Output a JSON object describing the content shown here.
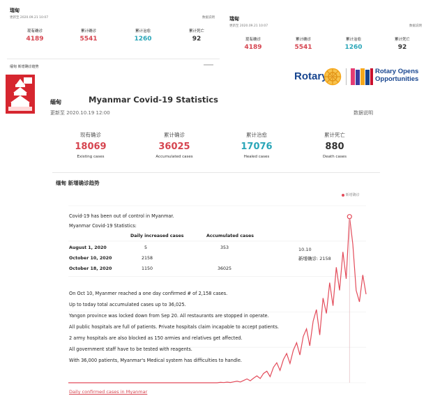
{
  "top_left": {
    "title": "瑞甸",
    "updated": "更新至 2020.09.21 10:07",
    "link": "数据说明",
    "stats": [
      {
        "label": "现有确诊",
        "value": "4189"
      },
      {
        "label": "累计确诊",
        "value": "5541"
      },
      {
        "label": "累计治愈",
        "value": "1260"
      },
      {
        "label": "累计死亡",
        "value": "92"
      }
    ],
    "trend": "缅甸 新增确诊趋势"
  },
  "top_right": {
    "title": "瑞甸",
    "updated": "更新至 2020.09.21 10:07",
    "link": "数据说明",
    "stats": [
      {
        "label": "现有确诊",
        "value": "4189"
      },
      {
        "label": "累计确诊",
        "value": "5541"
      },
      {
        "label": "累计治愈",
        "value": "1260"
      },
      {
        "label": "累计死亡",
        "value": "92"
      }
    ]
  },
  "rotary": {
    "wordmark": "Rotary",
    "slogan_line1": "Rotary Opens",
    "slogan_line2": "Opportunities"
  },
  "main": {
    "title": "Myanmar Covid-19 Statistics",
    "country": "缅甸",
    "updated": "更新至 2020.10.19 12:00",
    "link": "数据说明",
    "stats": [
      {
        "label": "现有确诊",
        "value": "18069",
        "en": "Existing cases"
      },
      {
        "label": "累计确诊",
        "value": "36025",
        "en": "Accumulated cases"
      },
      {
        "label": "累计治愈",
        "value": "17076",
        "en": "Healed cases"
      },
      {
        "label": "累计死亡",
        "value": "880",
        "en": "Death cases"
      }
    ],
    "trend_title": "缅甸 新增确诊趋势",
    "legend": "新增确诊"
  },
  "notes": {
    "line1": "Covid-19 has been out of control in Myanmar.",
    "line2": "Myanmar Covid-19 Statistics:",
    "table": {
      "headers": [
        "Daily increased cases",
        "Accumulated cases"
      ],
      "rows": [
        {
          "date": "August 1, 2020",
          "daily": "5",
          "acc": "353"
        },
        {
          "date": "October 10, 2020",
          "daily": "2158",
          "acc": ""
        },
        {
          "date": "October 18, 2020",
          "daily": "1150",
          "acc": "36025"
        }
      ]
    },
    "paras": [
      "On Oct 10, Myanmer reached a one day confirmed # of 2,158 cases.",
      "Up to today total accumulated cases up to 36,025.",
      "Yangon province was locked down from Sep 20. All restaurants are stopped in operate.",
      "All public hospitals are full of patients. Private hospitals claim incapable to accept patients.",
      "2 army hospitals are also blocked as 150 armies and relatives get affected.",
      "All government staff have to be tested with reagents.",
      "With 36,000 patients, Myanmar's Medical system has difficulties to handle."
    ]
  },
  "tooltip": {
    "date": "10.10",
    "label": "新增确诊",
    "value": "2158"
  },
  "caption": "Daily confirmed cases in Myanmar",
  "colors": {
    "red": "#d64550",
    "teal": "#2aa6b8",
    "line": "#e34b5a",
    "rotary_blue": "#17458f",
    "rotary_gold": "#f7a81b"
  },
  "chart_data": {
    "type": "line",
    "title": "",
    "xlabel": "",
    "ylabel": "",
    "series": [
      {
        "name": "新增确诊",
        "values": [
          0,
          0,
          0,
          0,
          0,
          0,
          0,
          0,
          0,
          0,
          0,
          0,
          0,
          0,
          0,
          0,
          0,
          0,
          0,
          0,
          0,
          0,
          0,
          0,
          0,
          0,
          0,
          0,
          0,
          0,
          0,
          0,
          0,
          0,
          0,
          0,
          0,
          0,
          0,
          0,
          0,
          0,
          0,
          0,
          0,
          0,
          5,
          3,
          8,
          4,
          12,
          20,
          10,
          30,
          50,
          25,
          60,
          90,
          55,
          120,
          150,
          80,
          200,
          260,
          160,
          300,
          380,
          250,
          420,
          520,
          360,
          600,
          700,
          480,
          800,
          950,
          620,
          1100,
          900,
          1300,
          1000,
          1500,
          1200,
          1700,
          1350,
          2158,
          1800,
          1200,
          1050,
          1400,
          1150
        ]
      }
    ],
    "ylim": [
      0,
      2300
    ],
    "highlight": {
      "date": "10.10",
      "value": 2158
    }
  }
}
